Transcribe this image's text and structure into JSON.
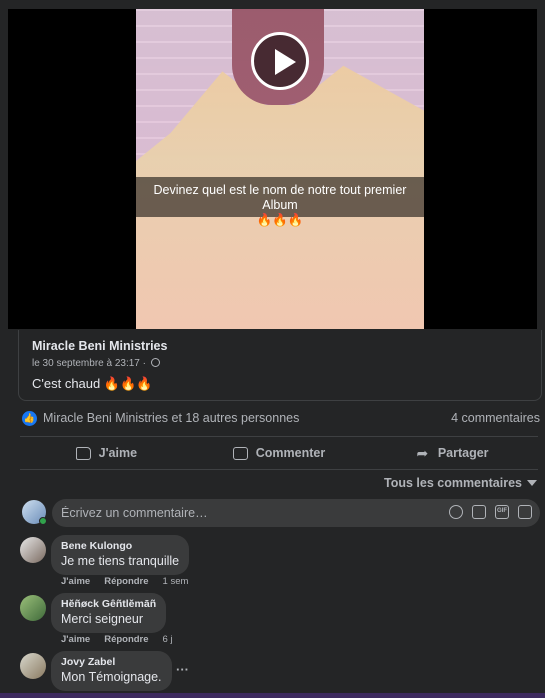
{
  "video": {
    "caption_line1": "Devinez quel est le nom de notre tout premier Album",
    "caption_line2": "🔥🔥🔥"
  },
  "post": {
    "author": "Miracle Beni Ministries",
    "timestamp": "le 30 septembre à 23:17 ·",
    "text": "C'est chaud 🔥🔥🔥"
  },
  "reactions": {
    "summary": "Miracle Beni Ministries et 18 autres personnes",
    "comments_count": "4 commentaires"
  },
  "actions": {
    "like": "J'aime",
    "comment": "Commenter",
    "share": "Partager"
  },
  "filter": {
    "label": "Tous les commentaires"
  },
  "composer": {
    "placeholder": "Écrivez un commentaire…"
  },
  "comments": [
    {
      "name": "Bene Kulongo",
      "text": "Je me tiens tranquille",
      "like": "J'aime",
      "reply": "Répondre",
      "time": "1 sem"
    },
    {
      "name": "Hĕñøck Gêñtlĕmāñ",
      "text": "Merci seigneur",
      "like": "J'aime",
      "reply": "Répondre",
      "time": "6 j"
    },
    {
      "name": "Jovy Zabel",
      "text": "Mon Témoignage."
    }
  ],
  "more_label": "···",
  "colors": {
    "background": "#242526",
    "bubble": "#3a3b3c",
    "accent": "#1877f2",
    "online": "#31a24c"
  }
}
